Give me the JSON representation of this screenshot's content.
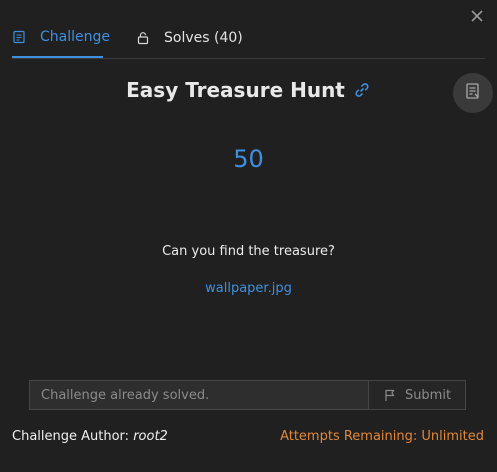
{
  "tabs": {
    "challenge_label": "Challenge",
    "solves_label": "Solves (40)"
  },
  "challenge": {
    "name": "Easy Treasure Hunt",
    "points": "50",
    "description": "Can you find the treasure?",
    "file_name": "wallpaper.jpg"
  },
  "form": {
    "placeholder": "Challenge already solved.",
    "submit_label": "Submit"
  },
  "footer": {
    "author_label": "Challenge Author:",
    "author_name": "root2",
    "attempts_text": "Attempts Remaining: Unlimited"
  },
  "icons": {
    "close": "close-icon",
    "challenge_tab": "document-icon",
    "solves_tab": "lock-icon",
    "link": "link-icon",
    "fab": "writeup-icon",
    "submit": "flag-icon"
  },
  "colors": {
    "accent": "#3f8fe0",
    "warning": "#e0873a",
    "background": "#202020"
  }
}
